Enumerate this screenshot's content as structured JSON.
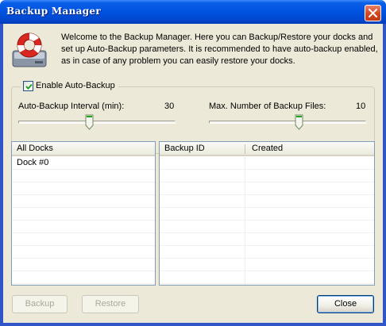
{
  "window": {
    "title": "Backup Manager"
  },
  "intro": {
    "text": "Welcome to the Backup Manager. Here you can Backup/Restore your docks and set up Auto-Backup parameters. It is recommended to have auto-backup enabled, as in case of any problem you can easily restore your docks."
  },
  "auto_backup": {
    "enabled_label": "Enable Auto-Backup",
    "enabled": true,
    "interval_label": "Auto-Backup Interval (min):",
    "interval_value": "30",
    "interval_level": 0.45,
    "max_files_label": "Max. Number of Backup Files:",
    "max_files_value": "10",
    "max_files_level": 0.58
  },
  "docks_list": {
    "header": "All Docks",
    "items": [
      "Dock #0"
    ]
  },
  "backups_table": {
    "columns": [
      "Backup ID",
      "Created"
    ],
    "rows": []
  },
  "buttons": {
    "backup": "Backup",
    "restore": "Restore",
    "close": "Close"
  },
  "colors": {
    "titlebar": "#0053e0",
    "window_bg": "#ece9d8",
    "close_button": "#d2461f",
    "list_border": "#7f9db9"
  }
}
